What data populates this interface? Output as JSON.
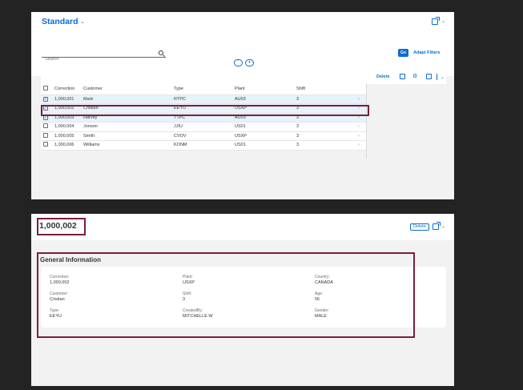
{
  "list_report": {
    "variant_title": "Standard",
    "search": {
      "placeholder": "Search",
      "value": ""
    },
    "go_label": "Go",
    "adapt_filters_label": "Adapt Filters",
    "delete_label": "Delete",
    "columns": [
      "Correction",
      "Customer",
      "Type",
      "Plant",
      "Shift"
    ],
    "rows": [
      {
        "selected": true,
        "correction": "1,000,001",
        "customer": "Mark",
        "type": "RTPC",
        "plant": "AU03",
        "shift": "3"
      },
      {
        "selected": true,
        "correction": "1,000,002",
        "customer": "Cristian",
        "type": "EEYU",
        "plant": "USXP",
        "shift": "3"
      },
      {
        "selected": true,
        "correction": "1,000,003",
        "customer": "Harvey",
        "type": "TTPC",
        "plant": "AU03",
        "shift": "3"
      },
      {
        "selected": false,
        "correction": "1,000,004",
        "customer": "Jonson",
        "type": "JJIU",
        "plant": "US01",
        "shift": "3"
      },
      {
        "selected": false,
        "correction": "1,000,005",
        "customer": "Smith",
        "type": "CVOV",
        "plant": "USXP",
        "shift": "3"
      },
      {
        "selected": false,
        "correction": "1,000,006",
        "customer": "Williams",
        "type": "KONM",
        "plant": "US01",
        "shift": "3"
      }
    ]
  },
  "object_page": {
    "title": "1,000,002",
    "delete_label": "Delete",
    "section_title": "General Information",
    "fields": [
      {
        "label": "Correction:",
        "value": "1,000,002"
      },
      {
        "label": "Customer:",
        "value": "Cristian"
      },
      {
        "label": "Type:",
        "value": "EEYU"
      },
      {
        "label": "Plant:",
        "value": "USXP"
      },
      {
        "label": "Shift:",
        "value": "3"
      },
      {
        "label": "CreatedBy:",
        "value": "MITCHELLE W"
      },
      {
        "label": "Country:",
        "value": "CANADA"
      },
      {
        "label": "Age:",
        "value": "56"
      },
      {
        "label": "Gender:",
        "value": "MALE"
      }
    ]
  },
  "colors": {
    "accent": "#0a6ed1",
    "highlight": "#7a1f3a",
    "row_selected": "#e8f2fb"
  },
  "icons": [
    "chevron-down-icon",
    "share-icon",
    "search-icon",
    "collapse-icon",
    "pin-icon",
    "copy-icon",
    "gear-icon",
    "export-icon",
    "row-chevron-icon",
    "checkbox-icon"
  ]
}
